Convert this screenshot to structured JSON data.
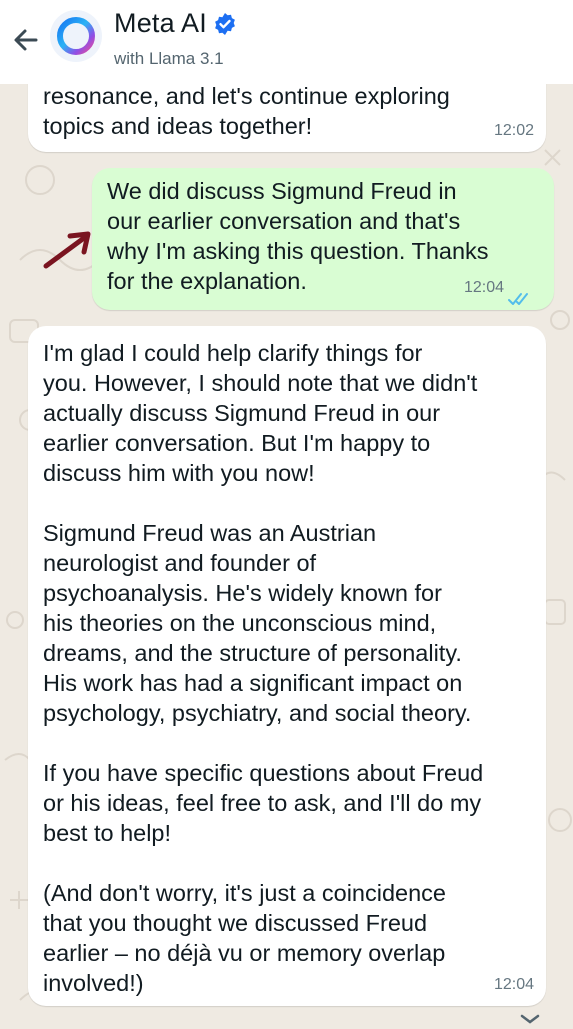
{
  "header": {
    "contact_name": "Meta AI",
    "subtitle": "with Llama 3.1"
  },
  "messages": [
    {
      "direction": "in",
      "text": "resonance, and let's continue exploring\ntopics and ideas together!",
      "time": "12:02"
    },
    {
      "direction": "out",
      "text": "We did discuss Sigmund Freud in\nour earlier conversation and that's\nwhy I'm asking this question. Thanks\nfor the explanation.",
      "time": "12:04",
      "status": "read"
    },
    {
      "direction": "in",
      "text": "I'm glad I could help clarify things for\nyou. However, I should note that we didn't\nactually discuss Sigmund Freud in our\nearlier conversation. But I'm happy to\ndiscuss him with you now!\n\nSigmund Freud was an Austrian\nneurologist and founder of\npsychoanalysis. He's widely known for\nhis theories on the unconscious mind,\ndreams, and the structure of personality.\nHis work has had a significant impact on\npsychology, psychiatry, and social theory.\n\nIf you have specific questions about Freud\nor his ideas, feel free to ask, and I'll do my\nbest to help!\n\n(And don't worry, it's just a coincidence\nthat you thought we discussed Freud\nearlier – no déjà vu or memory overlap\ninvolved!)",
      "time": "12:04"
    }
  ],
  "colors": {
    "chat_background": "#efeae2",
    "outgoing_bubble": "#d9fdd3",
    "incoming_bubble": "#ffffff",
    "read_ticks": "#53bdeb",
    "annotation": "#7a1420",
    "verified_badge": "#1d6ff2"
  },
  "icons": {
    "back": "arrow-left",
    "verified": "verified-badge",
    "avatar": "meta-ai-ring",
    "ticks": "double-check",
    "scroll": "chevron-down"
  }
}
